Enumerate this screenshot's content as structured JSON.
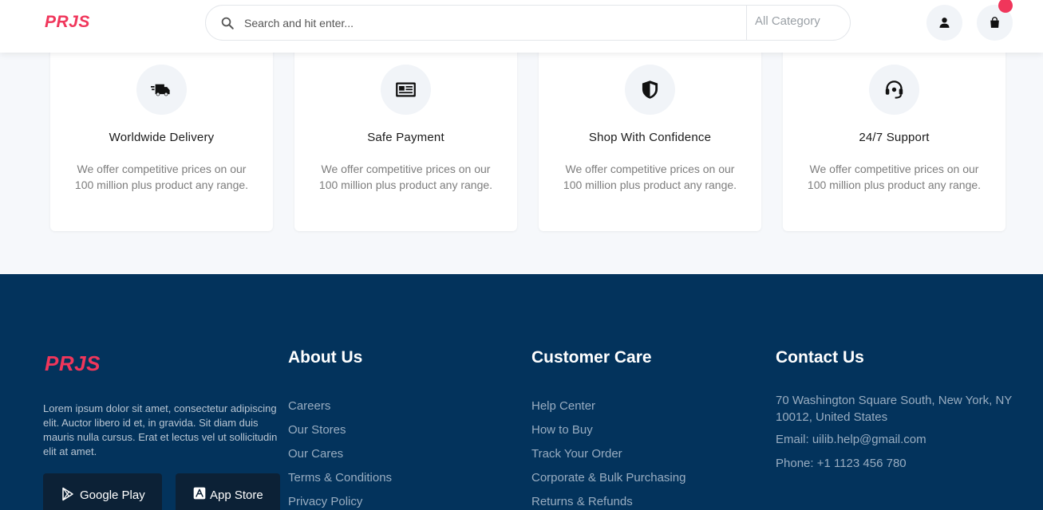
{
  "header": {
    "logo": "PRJS",
    "search_placeholder": "Search and hit enter...",
    "category": "All Category"
  },
  "features": [
    {
      "icon": "delivery-truck-icon",
      "title": "Worldwide Delivery",
      "desc": "We offer competitive prices on our 100 million plus product any range."
    },
    {
      "icon": "payment-card-icon",
      "title": "Safe Payment",
      "desc": "We offer competitive prices on our 100 million plus product any range."
    },
    {
      "icon": "shield-icon",
      "title": "Shop With Confidence",
      "desc": "We offer competitive prices on our 100 million plus product any range."
    },
    {
      "icon": "headset-icon",
      "title": "24/7 Support",
      "desc": "We offer competitive prices on our 100 million plus product any range."
    }
  ],
  "footer": {
    "logo": "PRJS",
    "description": "Lorem ipsum dolor sit amet, consectetur adipiscing elit. Auctor libero id et, in gravida. Sit diam duis mauris nulla cursus. Erat et lectus vel ut sollicitudin elit at amet.",
    "google_play": "Google Play",
    "app_store": "App Store",
    "about": {
      "title": "About Us",
      "links": [
        "Careers",
        "Our Stores",
        "Our Cares",
        "Terms & Conditions",
        "Privacy Policy"
      ]
    },
    "care": {
      "title": "Customer Care",
      "links": [
        "Help Center",
        "How to Buy",
        "Track Your Order",
        "Corporate & Bulk Purchasing",
        "Returns & Refunds"
      ]
    },
    "contact": {
      "title": "Contact Us",
      "address": "70 Washington Square South, New York, NY 10012, United States",
      "email": "Email: uilib.help@gmail.com",
      "phone": "Phone: +1 1123 456 780"
    }
  },
  "colors": {
    "brand": "#f0365b",
    "footer_bg": "#03335c",
    "page_bg": "#f6f8fb"
  }
}
